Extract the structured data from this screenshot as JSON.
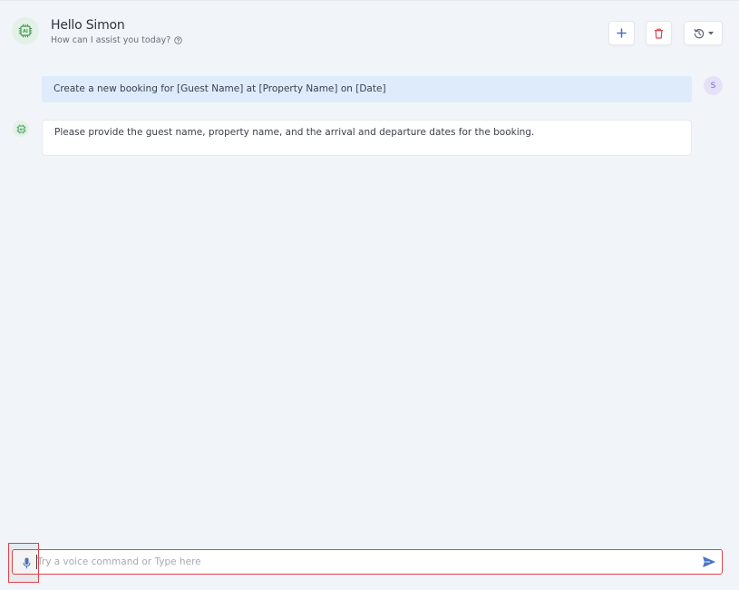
{
  "header": {
    "greeting": "Hello Simon",
    "subtitle": "How can I assist you today?",
    "avatar_icon": "ai-chip-icon"
  },
  "toolbar": {
    "add_icon": "plus-icon",
    "delete_icon": "trash-icon",
    "history_icon": "history-icon",
    "history_dropdown_icon": "caret-down-icon"
  },
  "conversation": {
    "messages": [
      {
        "role": "user",
        "avatar_initial": "S",
        "text": "Create a new booking for [Guest Name] at [Property Name] on [Date]"
      },
      {
        "role": "assistant",
        "avatar_icon": "ai-chip-icon",
        "text": "Please provide the guest name, property name, and the arrival and departure dates for the booking."
      }
    ]
  },
  "composer": {
    "placeholder": "Try a voice command or Type here",
    "value": "",
    "mic_icon": "microphone-icon",
    "send_icon": "send-icon"
  },
  "colors": {
    "background": "#f1f4f8",
    "user_bubble": "#ddebfb",
    "accent_blue": "#4a72c4",
    "danger_red": "#e0434a",
    "ai_green": "#3a9a4c"
  }
}
